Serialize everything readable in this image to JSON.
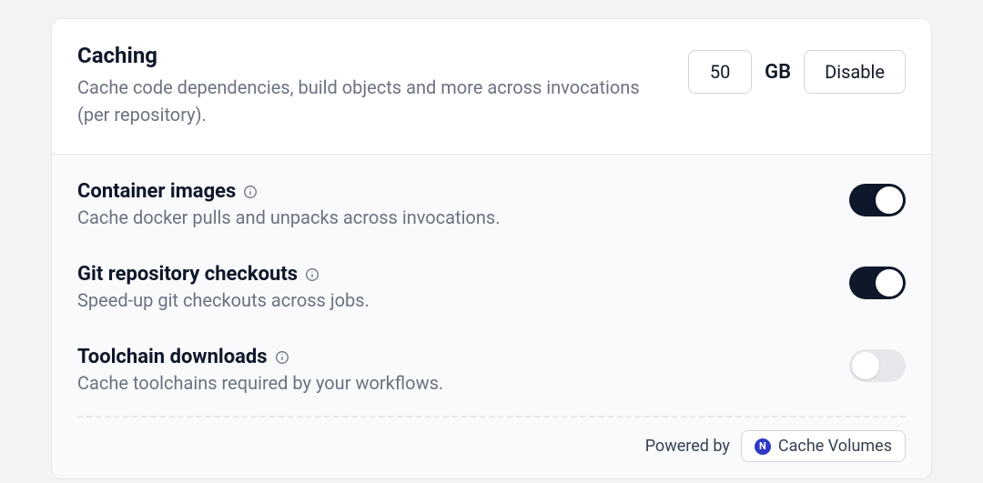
{
  "caching": {
    "title": "Caching",
    "description": "Cache code dependencies, build objects and more across invocations (per repository).",
    "size_value": "50",
    "size_unit": "GB",
    "disable_label": "Disable"
  },
  "settings": {
    "container_images": {
      "title": "Container images",
      "description": "Cache docker pulls and unpacks across invocations.",
      "enabled": true
    },
    "git_checkouts": {
      "title": "Git repository checkouts",
      "description": "Speed-up git checkouts across jobs.",
      "enabled": true
    },
    "toolchain_downloads": {
      "title": "Toolchain downloads",
      "description": "Cache toolchains required by your workflows.",
      "enabled": false
    }
  },
  "footer": {
    "powered_by_label": "Powered by",
    "badge_text": "Cache Volumes",
    "badge_icon_letter": "N"
  }
}
